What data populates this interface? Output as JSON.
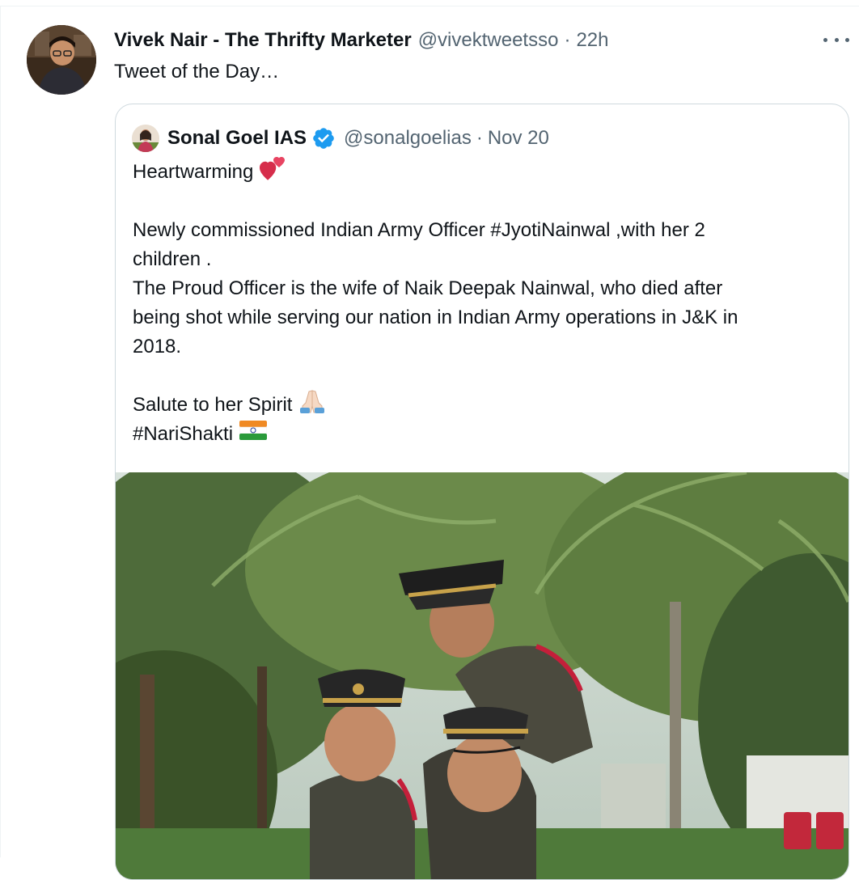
{
  "tweet": {
    "author_name": "Vivek Nair - The Thrifty Marketer",
    "author_handle": "@vivektweetsso",
    "separator": "·",
    "time": "22h",
    "text": "Tweet of the Day…",
    "more_icon": "more-horizontal-icon"
  },
  "quoted_tweet": {
    "author_name": "Sonal Goel IAS",
    "verified_icon": "verified-badge-icon",
    "author_handle": "@sonalgoelias",
    "separator": "·",
    "date": "Nov 20",
    "lines": {
      "l1": "Heartwarming",
      "l2": "Newly commissioned Indian Army Officer #JyotiNainwal ,with her 2",
      "l3": "children .",
      "l4": "The Proud Officer is the wife of Naik Deepak Nainwal, who died after",
      "l5": "being shot while serving our nation in Indian Army operations in J&K in",
      "l6": "2018.",
      "l7": "Salute to her Spirit",
      "l8": "#NariShakti"
    },
    "emojis": [
      "two-hearts-emoji",
      "folded-hands-emoji",
      "india-flag-emoji"
    ]
  },
  "colors": {
    "text_primary": "#0f1419",
    "text_secondary": "#536471",
    "verified_blue": "#1d9bf0",
    "card_border": "#cfd9de"
  }
}
